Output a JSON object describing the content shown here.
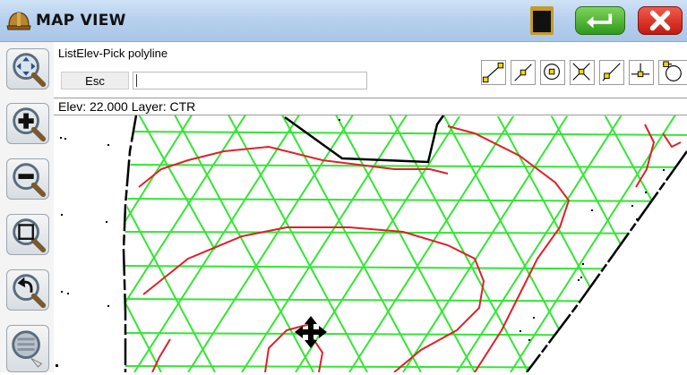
{
  "window": {
    "title": "MAP VIEW"
  },
  "command": {
    "label": "ListElev-Pick polyline",
    "esc_label": "Esc",
    "input_value": ""
  },
  "status": {
    "text": "Elev:  22.000  Layer: CTR"
  },
  "icons": {
    "title": "hardhat-icon",
    "stop": "stop-icon",
    "enter": "enter-icon",
    "close": "close-icon"
  },
  "colors": {
    "tin": "#33e633",
    "contour": "#e0202a",
    "boundary": "#000000",
    "titlebar": "#b7d1ee"
  }
}
